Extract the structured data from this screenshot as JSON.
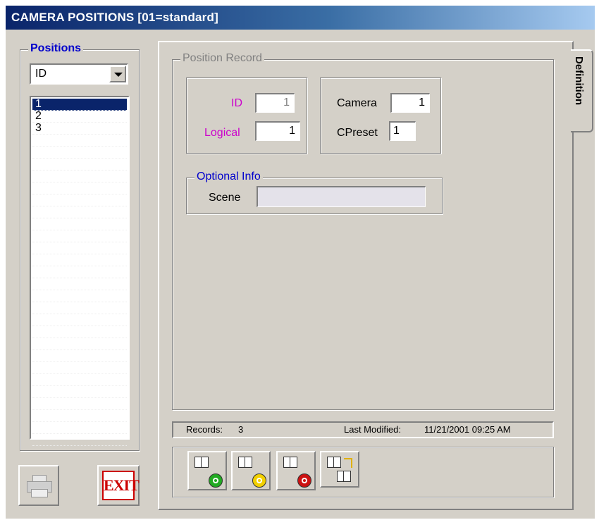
{
  "window": {
    "title": "CAMERA POSITIONS  [01=standard]"
  },
  "positions": {
    "group_label": "Positions",
    "sort_select": "ID",
    "items": [
      "1",
      "2",
      "3"
    ],
    "selected_index": 0
  },
  "tab": {
    "label": "Definition"
  },
  "record": {
    "group_label": "Position Record",
    "id_label": "ID",
    "id_value": "1",
    "logical_label": "Logical",
    "logical_value": "1",
    "camera_label": "Camera",
    "camera_value": "1",
    "cpreset_label": "CPreset",
    "cpreset_value": "1",
    "optional": {
      "group_label": "Optional Info",
      "scene_label": "Scene",
      "scene_value": ""
    }
  },
  "status": {
    "records_label": "Records:",
    "records_value": "3",
    "modified_label": "Last Modified:",
    "modified_value": "11/21/2001 09:25 AM"
  },
  "toolbar": {
    "add_icon": "add-record-icon",
    "edit_icon": "edit-record-icon",
    "delete_icon": "delete-record-icon",
    "copy_icon": "copy-record-icon"
  },
  "bottom": {
    "exit_label": "EXIT",
    "print_icon": "printer-icon"
  },
  "colors": {
    "title_start": "#0a246a",
    "title_end": "#a6caf0",
    "group_title": "#0000cc",
    "key_label": "#cc00cc",
    "disabled_text": "#808080",
    "exit_red": "#cc0000",
    "add_green": "#22aa22",
    "edit_yellow": "#f2d000",
    "delete_red": "#cc1111"
  }
}
